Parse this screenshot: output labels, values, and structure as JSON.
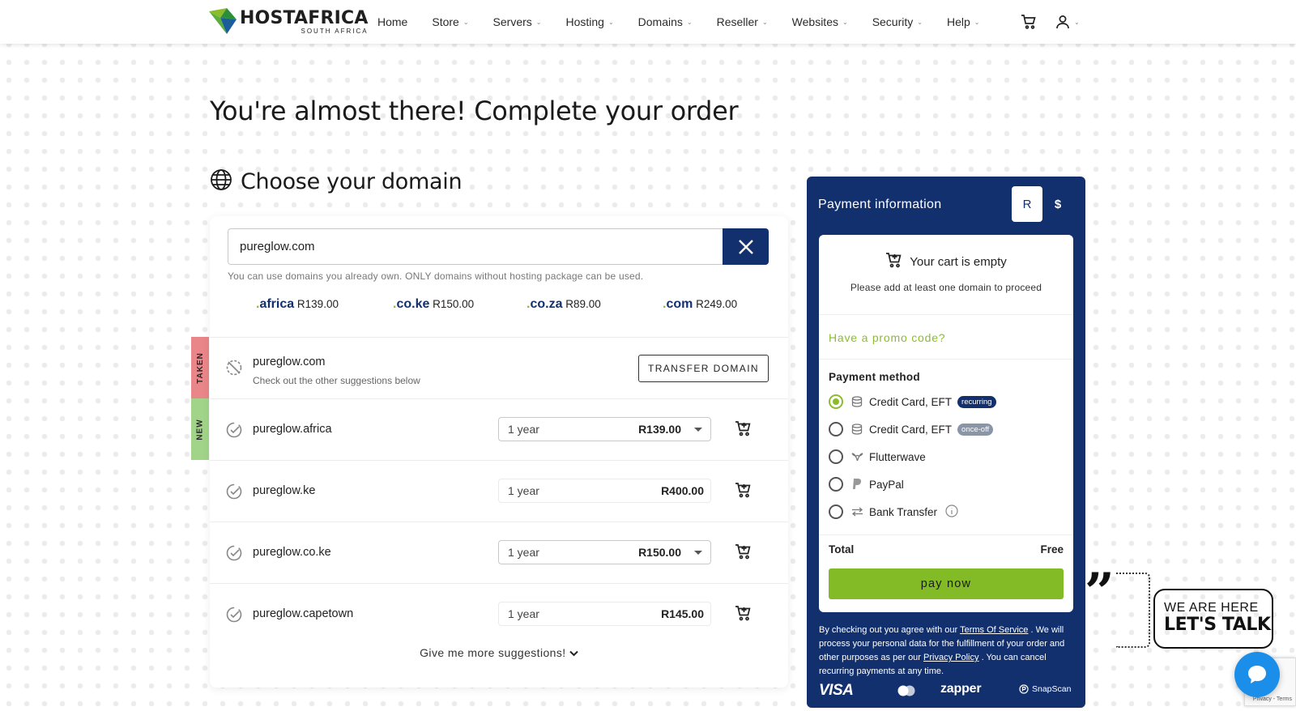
{
  "brand": {
    "name": "HOSTAFRICA",
    "tagline": "SOUTH AFRICA"
  },
  "nav": {
    "items": [
      {
        "label": "Home",
        "dropdown": false
      },
      {
        "label": "Store",
        "dropdown": true
      },
      {
        "label": "Servers",
        "dropdown": true
      },
      {
        "label": "Hosting",
        "dropdown": true
      },
      {
        "label": "Domains",
        "dropdown": true
      },
      {
        "label": "Reseller",
        "dropdown": true
      },
      {
        "label": "Websites",
        "dropdown": true
      },
      {
        "label": "Security",
        "dropdown": true
      },
      {
        "label": "Help",
        "dropdown": true
      }
    ],
    "cart_icon": "cart-icon",
    "account_icon": "user-icon"
  },
  "page": {
    "title": "You're almost there! Complete your order"
  },
  "domain_section": {
    "title": "Choose your domain",
    "icon": "globe-icon",
    "search_value": "pureglow.com",
    "hint": "You can use domains you already own. ONLY domains without hosting package can be used.",
    "tlds": [
      {
        "ext": "africa",
        "price": "R139.00"
      },
      {
        "ext": "co.ke",
        "price": "R150.00"
      },
      {
        "ext": "co.za",
        "price": "R89.00"
      },
      {
        "ext": "com",
        "price": "R249.00"
      }
    ],
    "taken": {
      "tag": "TAKEN",
      "domain": "pureglow.com",
      "note": "Check out the other suggestions below",
      "action": "TRANSFER DOMAIN"
    },
    "new_tag": "NEW",
    "suggestions": [
      {
        "domain": "pureglow.africa",
        "period": "1 year",
        "price": "R139.00",
        "has_dropdown": true
      },
      {
        "domain": "pureglow.ke",
        "period": "1 year",
        "price": "R400.00",
        "has_dropdown": false
      },
      {
        "domain": "pureglow.co.ke",
        "period": "1 year",
        "price": "R150.00",
        "has_dropdown": true
      },
      {
        "domain": "pureglow.capetown",
        "period": "1 year",
        "price": "R145.00",
        "has_dropdown": false
      }
    ],
    "more_label": "Give me more suggestions!"
  },
  "payment": {
    "title": "Payment information",
    "currencies": [
      "R",
      "$"
    ],
    "selected_currency": "R",
    "cart_empty": "Your cart is empty",
    "cart_sub": "Please add at least one domain to proceed",
    "promo": "Have a promo code?",
    "method_title": "Payment method",
    "methods": [
      {
        "label": "Credit Card, EFT",
        "badge": "recurring",
        "selected": true,
        "icon": "coins-icon"
      },
      {
        "label": "Credit Card, EFT",
        "badge": "once-off",
        "selected": false,
        "icon": "coins-icon"
      },
      {
        "label": "Flutterwave",
        "badge": "",
        "selected": false,
        "icon": "flutterwave-icon"
      },
      {
        "label": "PayPal",
        "badge": "",
        "selected": false,
        "icon": "paypal-icon"
      },
      {
        "label": "Bank Transfer",
        "badge": "",
        "selected": false,
        "icon": "transfer-icon"
      }
    ],
    "total_label": "Total",
    "total_value": "Free",
    "pay_label": "pay now",
    "legal": {
      "p1": "By checking out you agree with our",
      "tos": "Terms Of Service",
      "p2": ". We will process your personal data for the fulfillment of your order and other purposes as per our",
      "privacy": "Privacy Policy",
      "p3": ". You can cancel recurring payments at any time."
    },
    "logos": {
      "visa": "VISA",
      "zapper": "zapper",
      "snapscan": "SnapScan"
    }
  },
  "talk": {
    "line1": "WE ARE HERE",
    "line2": "LET'S TALK"
  },
  "recaptcha": {
    "terms": "Privacy - Terms"
  },
  "colors": {
    "navy": "#13306e",
    "green": "#83bb26",
    "taken": "#e9868a",
    "new": "#a1d488"
  }
}
